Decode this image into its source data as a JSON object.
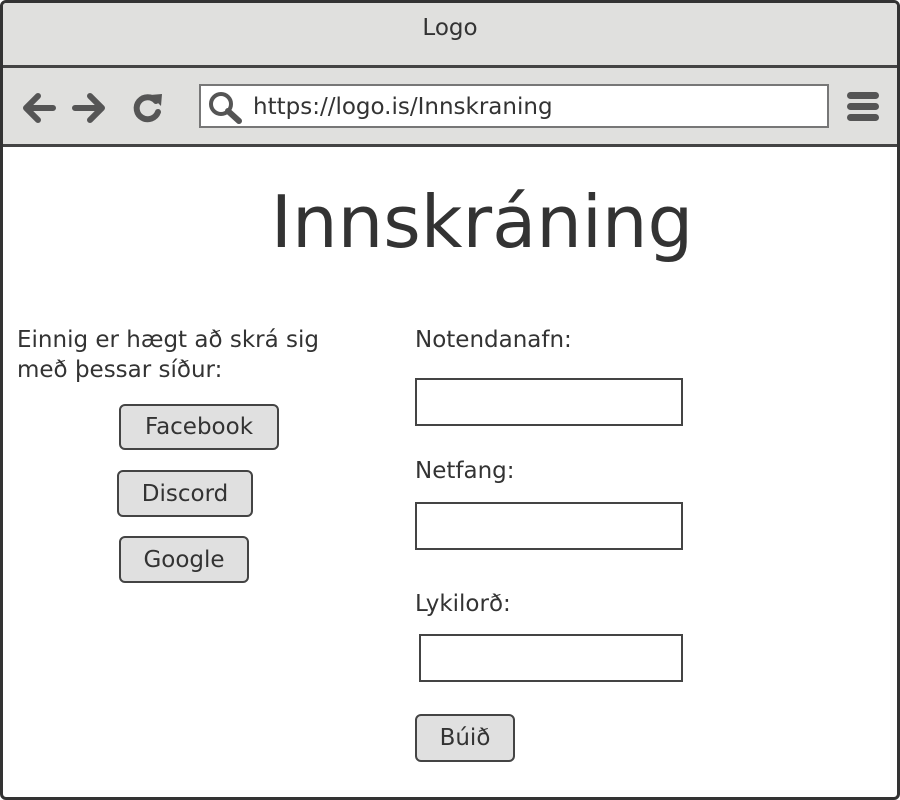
{
  "window": {
    "title": "Logo"
  },
  "toolbar": {
    "back_icon": "arrow-left-icon",
    "forward_icon": "arrow-right-icon",
    "reload_icon": "reload-icon",
    "search_icon": "search-icon",
    "menu_icon": "hamburger-menu-icon",
    "url": "https://logo.is/Innskraning"
  },
  "page": {
    "title": "Innskráning",
    "social_login": {
      "intro": "Einnig er hægt að skrá sig með þessar síður:",
      "buttons": [
        "Facebook",
        "Discord",
        "Google"
      ]
    },
    "form": {
      "username_label": "Notendanafn:",
      "username_value": "",
      "email_label": "Netfang:",
      "email_value": "",
      "password_label": "Lykilorð:",
      "password_value": "",
      "submit_label": "Búið"
    }
  },
  "colors": {
    "chrome_bg": "#e0e0de",
    "border": "#333333",
    "text": "#333333",
    "button_bg": "#e0e0e0"
  }
}
